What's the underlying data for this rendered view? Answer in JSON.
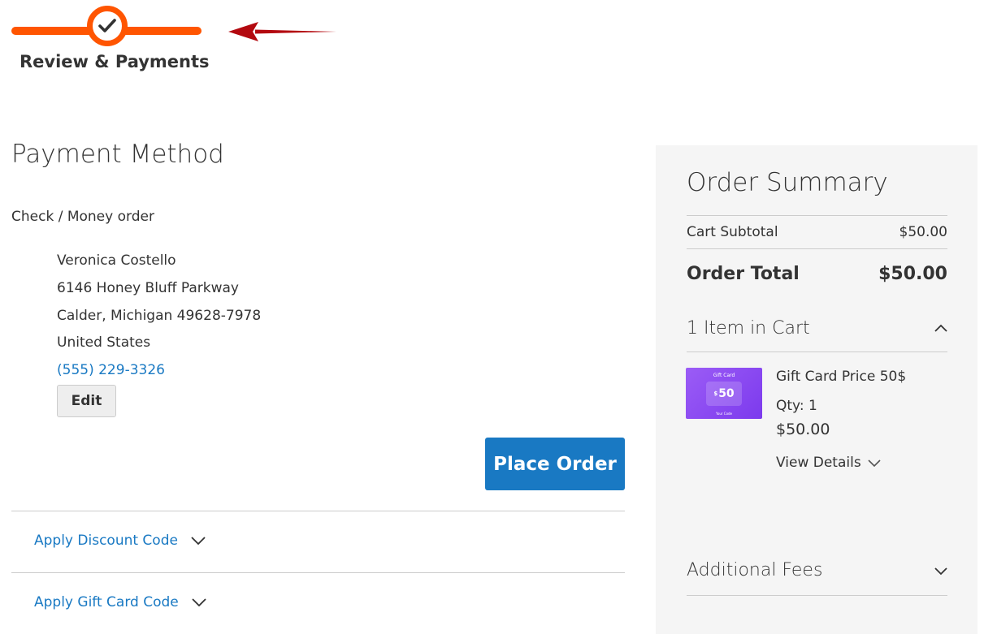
{
  "progress": {
    "step_title": "Review & Payments",
    "accent_color": "#ff5501",
    "step_icon": "checkmark-icon"
  },
  "annotation": {
    "icon": "red-arrow-icon",
    "color": "#b3090f"
  },
  "payment": {
    "title": "Payment Method",
    "method": "Check / Money order",
    "billing_address": {
      "name": "Veronica Costello",
      "street": "6146 Honey Bluff Parkway",
      "city_line": "Calder, Michigan 49628-7978",
      "country": "United States",
      "phone": "(555) 229-3326"
    },
    "edit_label": "Edit",
    "place_order_label": "Place Order",
    "primary_color": "#1979c3",
    "discount_label": "Apply Discount Code",
    "gift_card_label": "Apply Gift Card Code"
  },
  "summary": {
    "title": "Order Summary",
    "subtotal_label": "Cart Subtotal",
    "subtotal_value": "$50.00",
    "total_label": "Order Total",
    "total_value": "$50.00",
    "items_title": "1 Item in Cart",
    "item": {
      "name": "Gift Card Price 50$",
      "qty": "Qty: 1",
      "price": "$50.00",
      "view_details": "View Details",
      "image": {
        "header": "Gift Card",
        "currency": "$",
        "amount": "50",
        "footer": "Your Code"
      }
    },
    "fees_title": "Additional Fees"
  }
}
